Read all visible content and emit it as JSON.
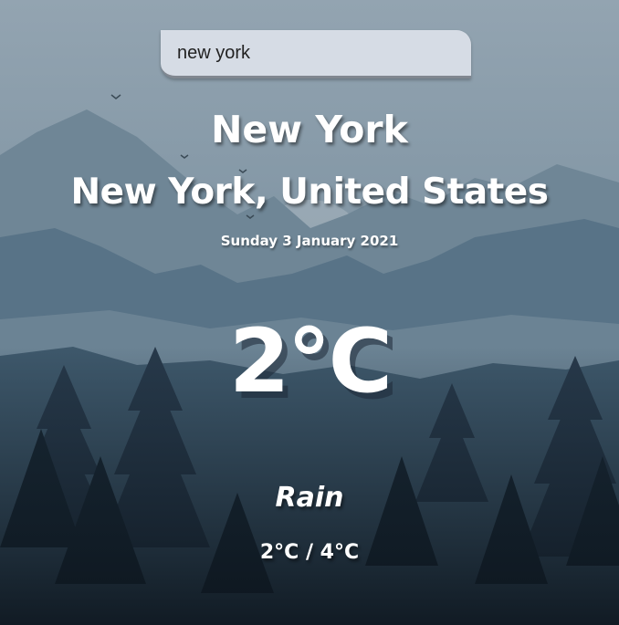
{
  "search": {
    "value": "new york"
  },
  "location": {
    "city": "New York",
    "country": "New York, United States"
  },
  "date": "Sunday 3 January 2021",
  "weather": {
    "temperature": "2°C",
    "description": "Rain",
    "hi_low": "2°C / 4°C"
  }
}
